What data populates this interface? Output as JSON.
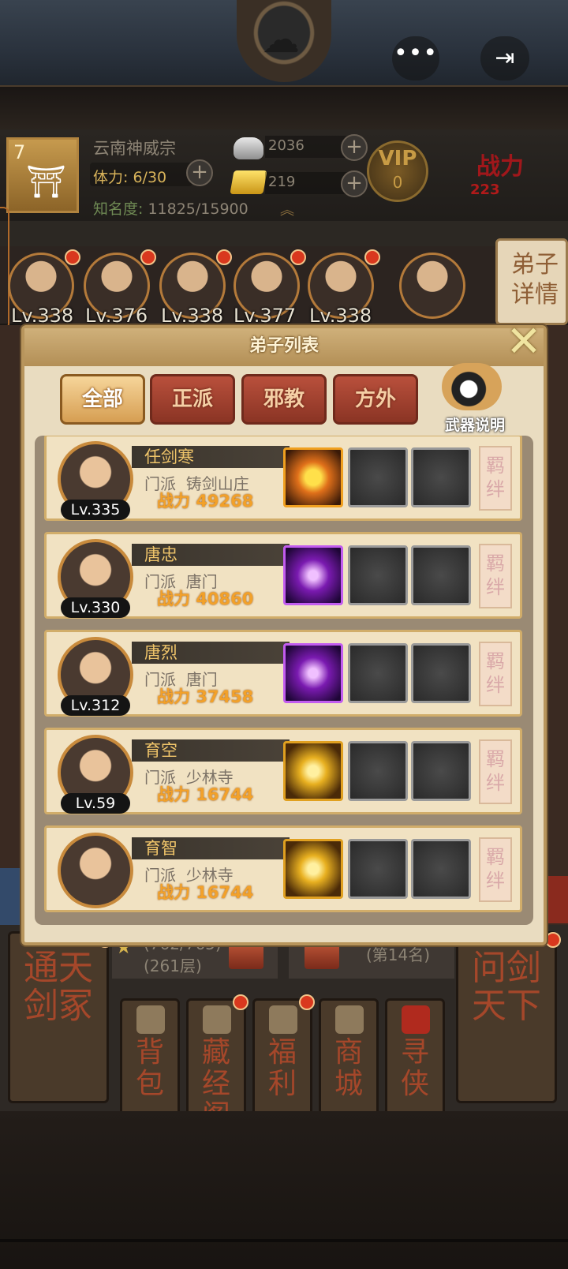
{
  "header": {
    "menu_icon": "more-dots-icon",
    "exit_icon": "exit-icon"
  },
  "status": {
    "level": "7",
    "sect_name": "云南神威宗",
    "stamina_label": "体力:",
    "stamina_value": "6/30",
    "fame_label": "知名度:",
    "fame_value": "11825/15900",
    "silver": "2036",
    "gold": "219",
    "vip_label": "VIP",
    "vip_level": "0",
    "power_label": "战力",
    "power_value": "223"
  },
  "strip": {
    "levels": [
      "Lv.338",
      "Lv.376",
      "Lv.338",
      "Lv.377",
      "Lv.338"
    ],
    "side_tab": "弟子详情"
  },
  "modal": {
    "title": "弟子列表",
    "close_icon": "close-x-icon",
    "tabs": [
      "全部",
      "正派",
      "邪教",
      "方外"
    ],
    "active_tab": "全部",
    "weapon_info_label": "武器说明",
    "sect_prefix": "门派",
    "power_prefix": "战力",
    "bond_label": "羁绊",
    "disciples": [
      {
        "name": "任剑寒",
        "level": "Lv.335",
        "sect": "铸剑山庄",
        "power": "49268",
        "weapon": "fire"
      },
      {
        "name": "唐忠",
        "level": "Lv.330",
        "sect": "唐门",
        "power": "40860",
        "weapon": "purple"
      },
      {
        "name": "唐烈",
        "level": "Lv.312",
        "sect": "唐门",
        "power": "37458",
        "weapon": "purple"
      },
      {
        "name": "育空",
        "level": "Lv.59",
        "sect": "少林寺",
        "power": "16744",
        "weapon": "gold"
      },
      {
        "name": "育智",
        "level": "",
        "sect": "少林寺",
        "power": "16744",
        "weapon": "gold"
      }
    ]
  },
  "bottom": {
    "left_big": "通天剑冢",
    "right_big": "问剑天下",
    "progress_top": "(762/765)",
    "progress_bottom": "(261层)",
    "rank": "(第14名)",
    "small_buttons": [
      "背包",
      "藏经阁",
      "福利",
      "商城",
      "寻侠"
    ]
  },
  "colors": {
    "accent_gold": "#f0c56a",
    "power_orange": "#f2a12a",
    "tab_red": "#8a3424",
    "tab_active": "#d69e52"
  }
}
